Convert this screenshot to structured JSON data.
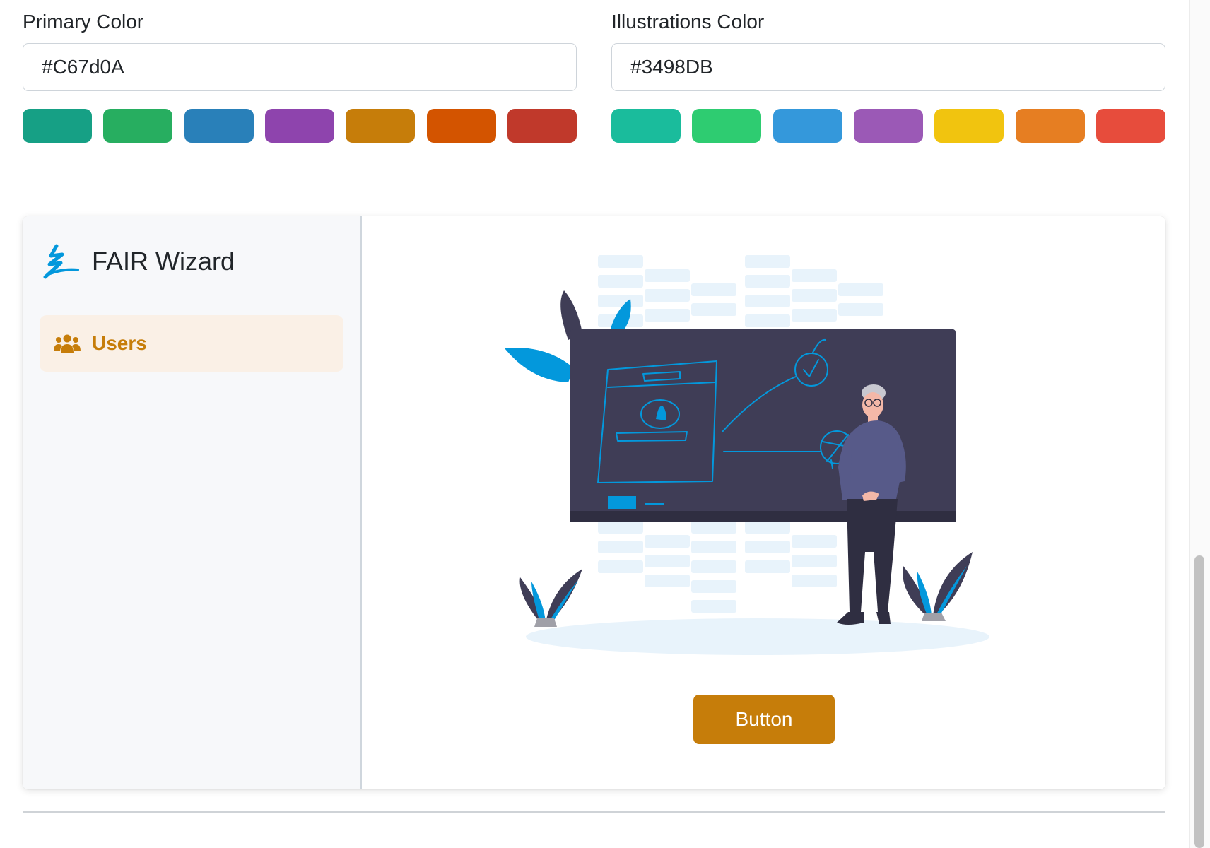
{
  "primary": {
    "label": "Primary Color",
    "value": "#C67d0A",
    "swatches": [
      "#16a085",
      "#27ae60",
      "#2980b9",
      "#8e44ad",
      "#c67d0a",
      "#d35400",
      "#c0392b"
    ]
  },
  "illustrations": {
    "label": "Illustrations Color",
    "value": "#3498DB",
    "swatches": [
      "#1abc9c",
      "#2ecc71",
      "#3498db",
      "#9b59b6",
      "#f1c40f",
      "#e67e22",
      "#e74c3c"
    ]
  },
  "preview": {
    "brand_name": "FAIR Wizard",
    "nav_items": [
      {
        "label": "Users",
        "icon": "users-icon"
      }
    ],
    "button_label": "Button"
  },
  "colors": {
    "primary_accent": "#c67d0a",
    "illustration_accent": "#0398dc",
    "nav_active_bg": "#faf0e6",
    "sidebar_bg": "#f7f8fa"
  }
}
